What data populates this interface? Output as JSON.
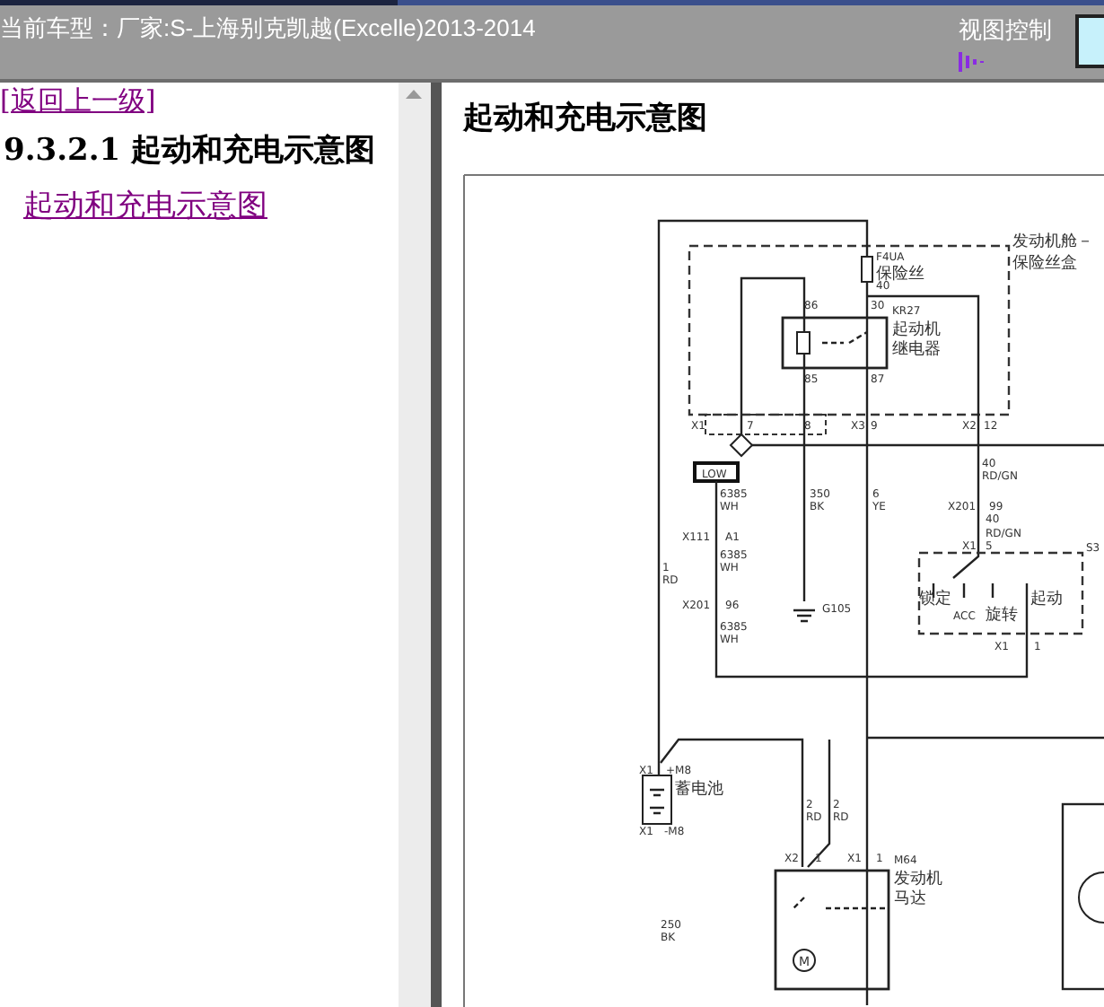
{
  "header": {
    "title": "当前车型：厂家:S-上海别克凯越(Excelle)2013-2014",
    "view_control": "视图控制"
  },
  "sidebar": {
    "back_link": "[返回上一级]",
    "section_heading": "9.3.2.1 起动和充电示意图",
    "links": [
      "起动和充电示意图"
    ]
  },
  "content": {
    "heading": "起动和充电示意图",
    "diagram_labels": [
      "发动机舱－",
      "保险丝盒",
      "F4UA",
      "保险丝",
      "40",
      "86",
      "30",
      "KR27",
      "起动机",
      "继电器",
      "85",
      "87",
      "X1",
      "7",
      "8",
      "X3",
      "9",
      "X2",
      "12",
      "40",
      "RD/GN",
      "LOW",
      "6385",
      "WH",
      "350",
      "BK",
      "6",
      "YE",
      "X201",
      "99",
      "40",
      "X111",
      "A1",
      "RD/GN",
      "6385",
      "WH",
      "X1",
      "5",
      "S3",
      "1",
      "RD",
      "X201",
      "96",
      "6385",
      "WH",
      "G105",
      "锁定",
      "ACC",
      "旋转",
      "起动",
      "X1",
      "1",
      "X1",
      "+M8",
      "蓄电池",
      "X1",
      "-M8",
      "2",
      "RD",
      "2",
      "RD",
      "X2",
      "1",
      "X1",
      "1",
      "M64",
      "发动机",
      "马达",
      "M",
      "250",
      "BK"
    ]
  }
}
